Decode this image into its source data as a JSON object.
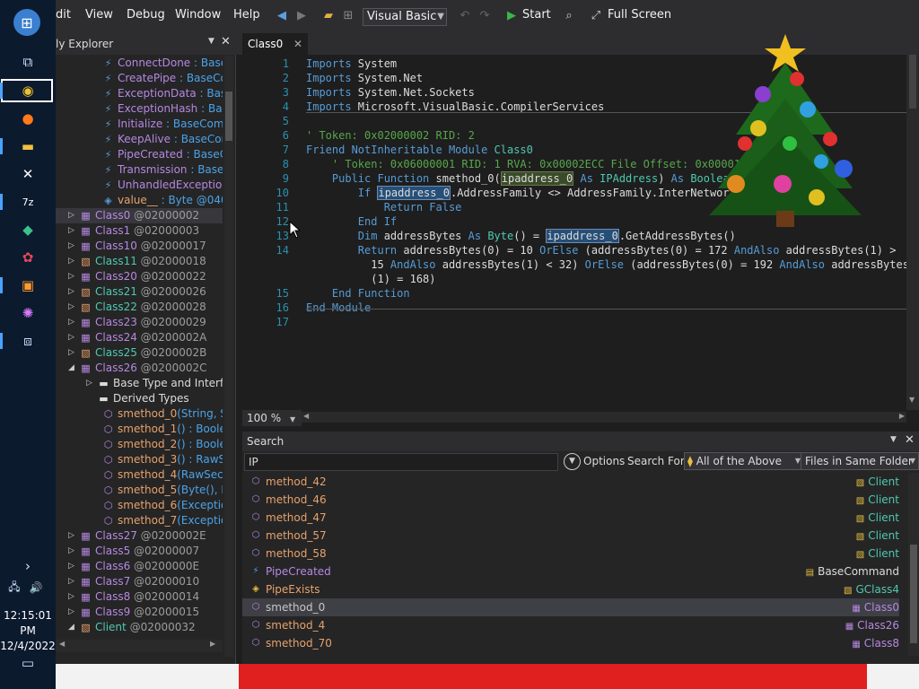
{
  "taskbar": {
    "icons": [
      "start-icon",
      "task-view-icon",
      "chrome-icon",
      "firefox-icon",
      "file-explorer-icon",
      "excel-icon",
      "7zip-icon",
      "app-icon",
      "app2-icon",
      "app3-icon",
      "app4-icon",
      "virtual-desktop-icon"
    ],
    "clock_time": "12:15:01 PM",
    "clock_date": "12/4/2022"
  },
  "menubar": {
    "items": [
      "dit",
      "View",
      "Debug",
      "Window",
      "Help"
    ],
    "language": "Visual Basic",
    "start_label": "Start",
    "fullscreen_label": "Full Screen"
  },
  "explorer": {
    "title": "ly Explorer",
    "rows": [
      {
        "name": "ConnectDone",
        "suffix": " : BaseCo",
        "kind": "event"
      },
      {
        "name": "CreatePipe",
        "suffix": " : BaseCom",
        "kind": "event"
      },
      {
        "name": "ExceptionData",
        "suffix": " : BaseC",
        "kind": "event"
      },
      {
        "name": "ExceptionHash",
        "suffix": " : Base",
        "kind": "event"
      },
      {
        "name": "Initialize",
        "suffix": " : BaseComma",
        "kind": "event"
      },
      {
        "name": "KeepAlive",
        "suffix": " : BaseComr",
        "kind": "event"
      },
      {
        "name": "PipeCreated",
        "suffix": " : BaseCo",
        "kind": "event"
      },
      {
        "name": "Transmission",
        "suffix": " : BaseCo",
        "kind": "event"
      },
      {
        "name": "UnhandledException",
        "suffix": " : ",
        "kind": "event"
      },
      {
        "name": "value__",
        "suffix": " : Byte @040000",
        "kind": "field"
      },
      {
        "name": "Class0",
        "suffix": " @02000002",
        "kind": "class",
        "selected": true
      },
      {
        "name": "Class1",
        "suffix": " @02000003",
        "kind": "class"
      },
      {
        "name": "Class10",
        "suffix": " @02000017",
        "kind": "class"
      },
      {
        "name": "Class11",
        "suffix": " @02000018",
        "kind": "class2"
      },
      {
        "name": "Class20",
        "suffix": " @02000022",
        "kind": "class"
      },
      {
        "name": "Class21",
        "suffix": " @02000026",
        "kind": "class2"
      },
      {
        "name": "Class22",
        "suffix": " @02000028",
        "kind": "class2"
      },
      {
        "name": "Class23",
        "suffix": " @02000029",
        "kind": "class"
      },
      {
        "name": "Class24",
        "suffix": " @0200002A",
        "kind": "class"
      },
      {
        "name": "Class25",
        "suffix": " @0200002B",
        "kind": "class2"
      },
      {
        "name": "Class26",
        "suffix": " @0200002C",
        "kind": "class",
        "expanded": true
      },
      {
        "name": "Base Type and Interfac",
        "suffix": "",
        "kind": "folder"
      },
      {
        "name": "Derived Types",
        "suffix": "",
        "kind": "folder2"
      },
      {
        "name": "smethod_0",
        "suffix": "(String, Stri",
        "kind": "method"
      },
      {
        "name": "smethod_1",
        "suffix": "() : Boolear",
        "kind": "method"
      },
      {
        "name": "smethod_2",
        "suffix": "() : Boolea",
        "kind": "method"
      },
      {
        "name": "smethod_3",
        "suffix": "() : RawSec",
        "kind": "method"
      },
      {
        "name": "smethod_4",
        "suffix": "(RawSecuri",
        "kind": "method"
      },
      {
        "name": "smethod_5",
        "suffix": "(Byte(), Byt",
        "kind": "method"
      },
      {
        "name": "smethod_6",
        "suffix": "(Exception)",
        "kind": "method"
      },
      {
        "name": "smethod_7",
        "suffix": "(Exception)",
        "kind": "method"
      },
      {
        "name": "Class27",
        "suffix": " @0200002E",
        "kind": "class"
      },
      {
        "name": "Class5",
        "suffix": " @02000007",
        "kind": "class"
      },
      {
        "name": "Class6",
        "suffix": " @0200000E",
        "kind": "class"
      },
      {
        "name": "Class7",
        "suffix": " @02000010",
        "kind": "class"
      },
      {
        "name": "Class8",
        "suffix": " @02000014",
        "kind": "class"
      },
      {
        "name": "Class9",
        "suffix": " @02000015",
        "kind": "class"
      },
      {
        "name": "Client",
        "suffix": " @02000032",
        "kind": "class2",
        "expanded": true
      }
    ]
  },
  "editor": {
    "tab_label": "Class0",
    "zoom": "100 %",
    "lines": [
      {
        "n": "1",
        "segs": [
          [
            "kw",
            "Imports "
          ],
          [
            "",
            "System"
          ]
        ]
      },
      {
        "n": "2",
        "segs": [
          [
            "kw",
            "Imports "
          ],
          [
            "",
            "System.Net"
          ]
        ]
      },
      {
        "n": "3",
        "segs": [
          [
            "kw",
            "Imports "
          ],
          [
            "",
            "System.Net.Sockets"
          ]
        ]
      },
      {
        "n": "4",
        "segs": [
          [
            "kw",
            "Imports "
          ],
          [
            "",
            "Microsoft.VisualBasic.CompilerServices"
          ]
        ]
      },
      {
        "n": "5",
        "segs": []
      },
      {
        "n": "6",
        "segs": [
          [
            "cm",
            "' Token: 0x02000002 RID: 2"
          ]
        ]
      },
      {
        "n": "7",
        "segs": [
          [
            "kw",
            "Friend NotInheritable Module "
          ],
          [
            "ty",
            "Class0"
          ]
        ]
      },
      {
        "n": "8",
        "segs": [
          [
            "cm",
            "    ' Token: 0x06000001 RID: 1 RVA: 0x00002ECC File Offset: 0x000010C"
          ]
        ]
      },
      {
        "n": "9",
        "segs": [
          [
            "",
            "    "
          ],
          [
            "kw",
            "Public Function "
          ],
          [
            "",
            "smethod_0("
          ],
          [
            "hl2",
            "ipaddress_0"
          ],
          [
            "",
            " "
          ],
          [
            "kw",
            "As "
          ],
          [
            "ty",
            "IPAddress"
          ],
          [
            "",
            ") "
          ],
          [
            "kw",
            "As "
          ],
          [
            "ty",
            "Boolean"
          ]
        ]
      },
      {
        "n": "10",
        "segs": [
          [
            "",
            "        "
          ],
          [
            "kw",
            "If "
          ],
          [
            "hl",
            "ipaddress_0"
          ],
          [
            "",
            ".AddressFamily <> AddressFamily.InterNetwor"
          ]
        ]
      },
      {
        "n": "11",
        "segs": [
          [
            "",
            "            "
          ],
          [
            "kw",
            "Return False"
          ]
        ]
      },
      {
        "n": "12",
        "segs": [
          [
            "",
            "        "
          ],
          [
            "kw",
            "End If"
          ]
        ]
      },
      {
        "n": "13",
        "segs": [
          [
            "",
            "        "
          ],
          [
            "kw",
            "Dim "
          ],
          [
            "",
            "addressBytes "
          ],
          [
            "kw",
            "As "
          ],
          [
            "ty",
            "Byte"
          ],
          [
            "",
            "() = "
          ],
          [
            "hl",
            "ipaddress_0"
          ],
          [
            "",
            ".GetAddressBytes()"
          ]
        ]
      },
      {
        "n": "14",
        "segs": [
          [
            "",
            "        "
          ],
          [
            "kw",
            "Return "
          ],
          [
            "",
            "addressBytes(0) = 10 "
          ],
          [
            "kw",
            "OrElse "
          ],
          [
            "",
            "(addressBytes(0) = 172 "
          ],
          [
            "kw",
            "AndAlso "
          ],
          [
            "",
            "addressBytes(1) >"
          ]
        ]
      },
      {
        "n": "",
        "segs": [
          [
            "",
            "          15 "
          ],
          [
            "kw",
            "AndAlso "
          ],
          [
            "",
            "addressBytes(1) < 32) "
          ],
          [
            "kw",
            "OrElse "
          ],
          [
            "",
            "(addressBytes(0) = 192 "
          ],
          [
            "kw",
            "AndAlso "
          ],
          [
            "",
            "addressBytes"
          ]
        ]
      },
      {
        "n": "",
        "segs": [
          [
            "",
            "          (1) = 168)"
          ]
        ]
      },
      {
        "n": "15",
        "segs": [
          [
            "",
            "    "
          ],
          [
            "kw",
            "End Function"
          ]
        ]
      },
      {
        "n": "16",
        "segs": [
          [
            "kw",
            "End Module"
          ]
        ]
      },
      {
        "n": "17",
        "segs": []
      }
    ]
  },
  "search": {
    "title": "Search",
    "query": "IP",
    "options_label": "Options",
    "search_for_label": "Search For:",
    "search_for_value": "All of the Above",
    "scope_value": "Files in Same Folder",
    "results": [
      {
        "name": "method_42",
        "owner": "Client",
        "kind": "method",
        "owner_kind": "class2"
      },
      {
        "name": "method_46",
        "owner": "Client",
        "kind": "method",
        "owner_kind": "class2"
      },
      {
        "name": "method_47",
        "owner": "Client",
        "kind": "method",
        "owner_kind": "class2"
      },
      {
        "name": "method_57",
        "owner": "Client",
        "kind": "method",
        "owner_kind": "class2"
      },
      {
        "name": "method_58",
        "owner": "Client",
        "kind": "method",
        "owner_kind": "class2"
      },
      {
        "name": "PipeCreated",
        "owner": "BaseCommand",
        "kind": "event",
        "owner_kind": "enum"
      },
      {
        "name": "PipeExists",
        "owner": "GClass4",
        "kind": "field",
        "owner_kind": "class2"
      },
      {
        "name": "smethod_0",
        "owner": "Class0",
        "kind": "method",
        "owner_kind": "class",
        "selected": true
      },
      {
        "name": "smethod_4",
        "owner": "Class26",
        "kind": "method",
        "owner_kind": "class"
      },
      {
        "name": "smethod_70",
        "owner": "Class8",
        "kind": "method",
        "owner_kind": "class"
      }
    ]
  }
}
